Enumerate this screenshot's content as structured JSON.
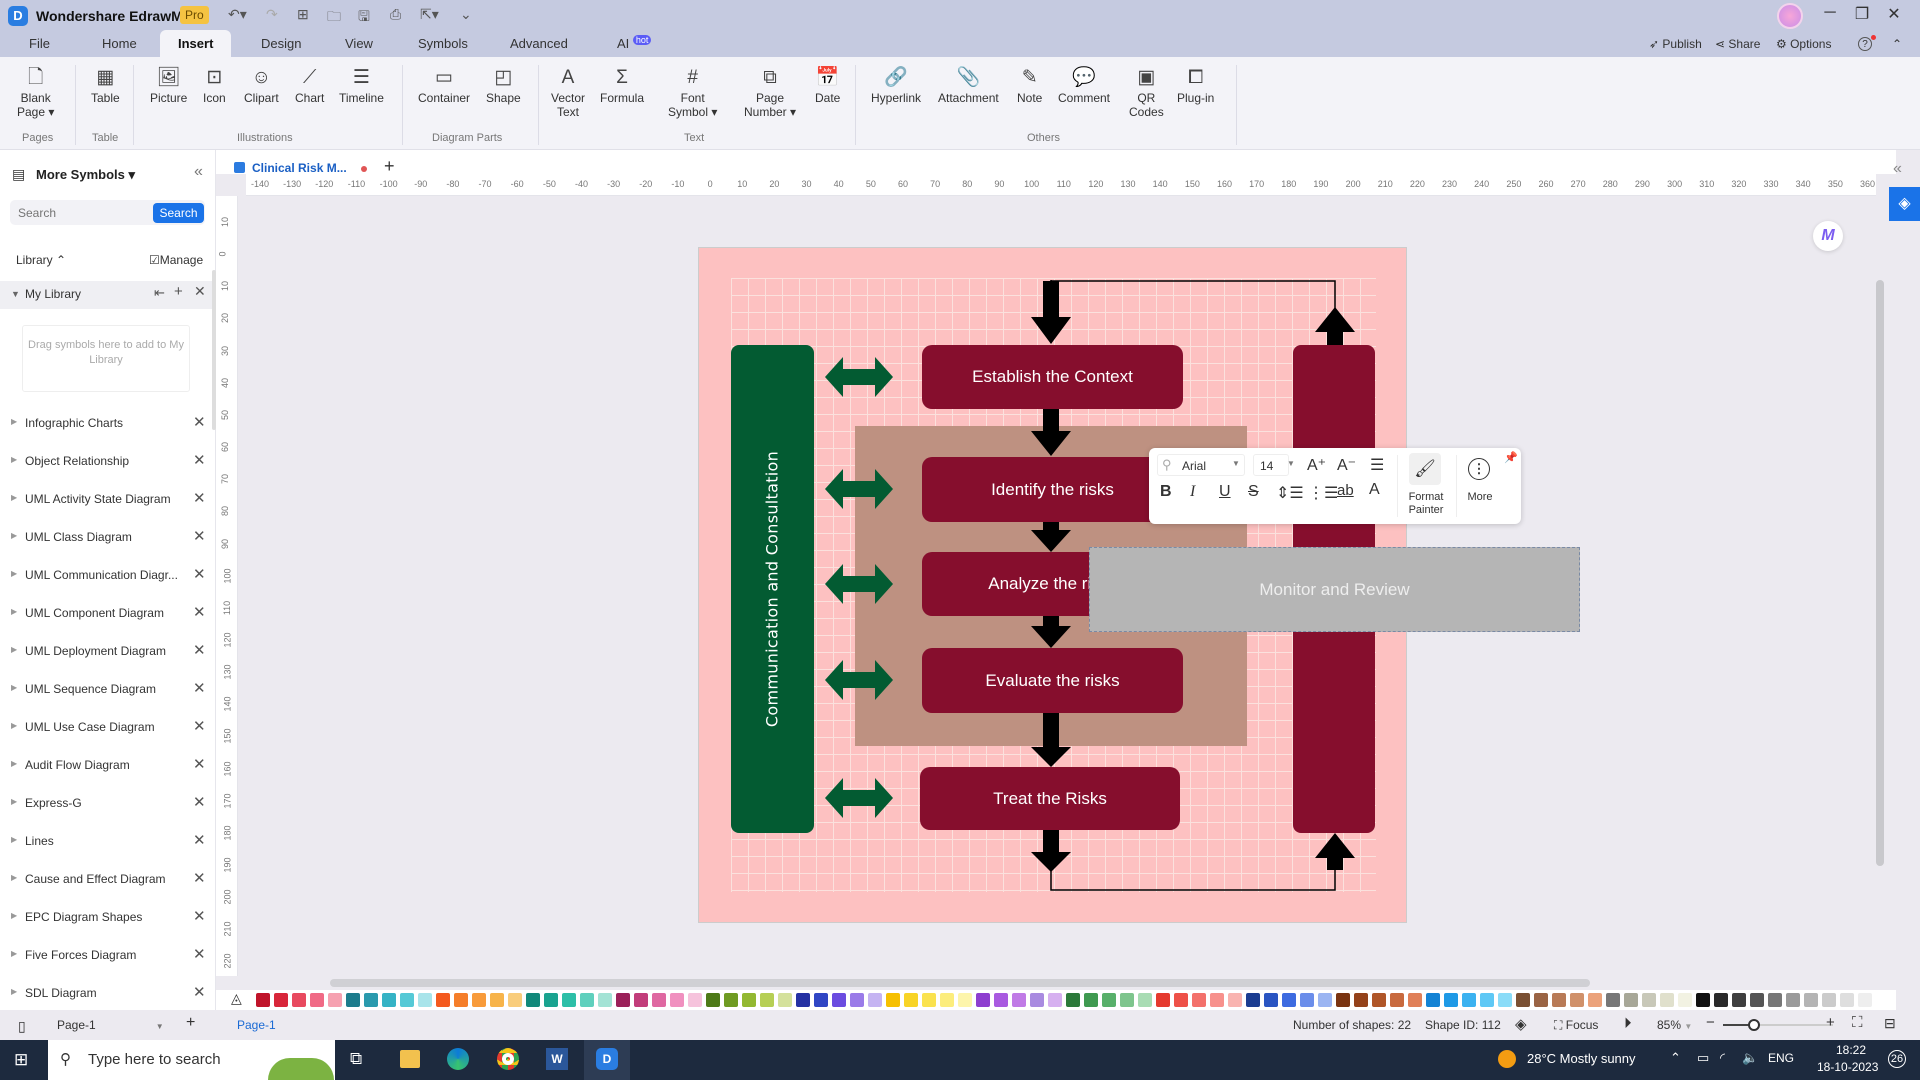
{
  "app": {
    "name": "Wondershare EdrawMax",
    "badge": "Pro"
  },
  "window_controls": {
    "minimize": "─",
    "restore": "❐",
    "close": "✕"
  },
  "menu_tabs": [
    {
      "label": "File"
    },
    {
      "label": "Home"
    },
    {
      "label": "Insert",
      "active": true
    },
    {
      "label": "Design"
    },
    {
      "label": "View"
    },
    {
      "label": "Symbols"
    },
    {
      "label": "Advanced"
    },
    {
      "label": "AI",
      "badge": "hot"
    }
  ],
  "top_actions": {
    "publish": "Publish",
    "share": "Share",
    "options": "Options",
    "help": "?"
  },
  "ribbon": {
    "items": [
      {
        "label": "Blank\nPage ▾",
        "icon": "blank-page-icon",
        "glyph": "🗋"
      },
      {
        "label": "Table",
        "icon": "table-icon",
        "glyph": "▦"
      },
      {
        "label": "Picture",
        "icon": "picture-icon",
        "glyph": "🖼"
      },
      {
        "label": "Icon",
        "icon": "icon-icon",
        "glyph": "⊡"
      },
      {
        "label": "Clipart",
        "icon": "clipart-icon",
        "glyph": "☺"
      },
      {
        "label": "Chart",
        "icon": "chart-icon",
        "glyph": "⟋"
      },
      {
        "label": "Timeline",
        "icon": "timeline-icon",
        "glyph": "☰"
      },
      {
        "label": "Container",
        "icon": "container-icon",
        "glyph": "▭"
      },
      {
        "label": "Shape",
        "icon": "shape-icon",
        "glyph": "◰"
      },
      {
        "label": "Vector\nText",
        "icon": "vector-text-icon",
        "glyph": "A"
      },
      {
        "label": "Formula",
        "icon": "formula-icon",
        "glyph": "Σ"
      },
      {
        "label": "Font\nSymbol ▾",
        "icon": "font-symbol-icon",
        "glyph": "#"
      },
      {
        "label": "Page\nNumber ▾",
        "icon": "page-number-icon",
        "glyph": "⧉"
      },
      {
        "label": "Date",
        "icon": "date-icon",
        "glyph": "📅"
      },
      {
        "label": "Hyperlink",
        "icon": "hyperlink-icon",
        "glyph": "🔗"
      },
      {
        "label": "Attachment",
        "icon": "attachment-icon",
        "glyph": "📎"
      },
      {
        "label": "Note",
        "icon": "note-icon",
        "glyph": "✎"
      },
      {
        "label": "Comment",
        "icon": "comment-icon",
        "glyph": "💬"
      },
      {
        "label": "QR\nCodes",
        "icon": "qr-codes-icon",
        "glyph": "▣"
      },
      {
        "label": "Plug-in",
        "icon": "plug-in-icon",
        "glyph": "⧠"
      }
    ],
    "groups": [
      "Pages",
      "Table",
      "Illustrations",
      "Diagram Parts",
      "Text",
      "Others"
    ]
  },
  "left_panel": {
    "title": "More Symbols",
    "search_placeholder": "Search",
    "search_button": "Search",
    "library_label": "Library",
    "manage_label": "Manage",
    "my_library": "My Library",
    "drop_hint": "Drag symbols here to add to My Library",
    "libraries": [
      "Infographic Charts",
      "Object Relationship",
      "UML Activity State Diagram",
      "UML Class Diagram",
      "UML Communication Diagr...",
      "UML Component Diagram",
      "UML Deployment Diagram",
      "UML Sequence Diagram",
      "UML Use Case Diagram",
      "Audit Flow Diagram",
      "Express-G",
      "Lines",
      "Cause and Effect Diagram",
      "EPC Diagram Shapes",
      "Five Forces Diagram",
      "SDL Diagram"
    ]
  },
  "document": {
    "tab_title": "Clinical Risk M...",
    "unsaved": true
  },
  "rulers": {
    "horizontal": [
      -140,
      -130,
      -120,
      -110,
      -100,
      -90,
      -80,
      -70,
      -60,
      -50,
      -40,
      -30,
      -20,
      -10,
      0,
      10,
      20,
      30,
      40,
      50,
      60,
      70,
      80,
      90,
      100,
      110,
      120,
      130,
      140,
      150,
      160,
      170,
      180,
      190,
      200,
      210,
      220,
      230,
      240,
      250,
      260,
      270,
      280,
      290,
      300,
      310,
      320,
      330,
      340,
      350,
      360
    ],
    "vertical": [
      10,
      0,
      10,
      20,
      30,
      40,
      50,
      60,
      70,
      80,
      90,
      100,
      110,
      120,
      130,
      140,
      150,
      160,
      170,
      180,
      190,
      200,
      210,
      220
    ]
  },
  "diagram": {
    "side_label": "Communication and Consultation",
    "steps": [
      "Establish the Context",
      "Identify the risks",
      "Analyze the risks",
      "Evaluate the risks",
      "Treat the Risks"
    ],
    "monitor_label": "Monitor and Review",
    "colors": {
      "page": "#fdc1c1",
      "green": "#035b32",
      "maroon": "#860e2d",
      "tan": "#be9181",
      "monitor": "#b5b5b5"
    }
  },
  "float_toolbar": {
    "font": "Arial",
    "size": "14",
    "format_painter": "Format\nPainter",
    "more": "More"
  },
  "palette": [
    "#c0142a",
    "#d8263a",
    "#e84a5f",
    "#f06a85",
    "#f6a1b0",
    "#1d7c8c",
    "#2a9aad",
    "#35b3c5",
    "#55c9d6",
    "#a8e4ea",
    "#f45a1e",
    "#f57e2a",
    "#f89b3a",
    "#f7b44a",
    "#f9cd7b",
    "#12897a",
    "#1aa38f",
    "#2dbfa7",
    "#5fd0bd",
    "#a3e3d5",
    "#9b2159",
    "#c23d7a",
    "#df68a1",
    "#f090bf",
    "#f6c3dc",
    "#4d7a17",
    "#6f9b22",
    "#93b831",
    "#b6cf54",
    "#d4e19b",
    "#2532a3",
    "#3046c4",
    "#6b4ce0",
    "#9a7be8",
    "#c5b4f2",
    "#f6c000",
    "#f8d426",
    "#fae24e",
    "#fced7c",
    "#fdf5ab",
    "#8e3ecf",
    "#a95ae0",
    "#c07ae6",
    "#a98be0",
    "#d6b0f0",
    "#2c7a3a",
    "#3f9a50",
    "#58b06a",
    "#7ec58d",
    "#a8dcb3",
    "#e53a2e",
    "#ee5148",
    "#f3716b",
    "#f7918c",
    "#f9b4b0",
    "#1b3d91",
    "#2a55c2",
    "#3d6be0",
    "#6b8eea",
    "#9bb5f2",
    "#7a3410",
    "#94421a",
    "#b05628",
    "#c86a3e",
    "#e08058",
    "#1483d4",
    "#1f9ae6",
    "#3bb2f0",
    "#5ec8f5",
    "#8adcf8",
    "#7a5033",
    "#9a6444",
    "#b87a56",
    "#d0916a",
    "#eba27a",
    "#777777",
    "#a8a898",
    "#c8c8b8",
    "#e0e0cc",
    "#f2f2e2",
    "#111111",
    "#2a2a2a",
    "#3f3f3f",
    "#555555",
    "#777777",
    "#9a9a9a",
    "#b4b4b4",
    "#cbcbcb",
    "#dedede",
    "#eeeeee"
  ],
  "status": {
    "page_select": "Page-1",
    "page_tab": "Page-1",
    "shapes": "Number of shapes: 22",
    "shape_id": "Shape ID: 112",
    "focus": "Focus",
    "zoom": "85%",
    "zoom_fraction": 0.28
  },
  "taskbar": {
    "search_placeholder": "Type here to search",
    "weather": "28°C  Mostly sunny",
    "lang": "ENG",
    "time": "18:22",
    "date": "18-10-2023",
    "notifications": "26"
  }
}
